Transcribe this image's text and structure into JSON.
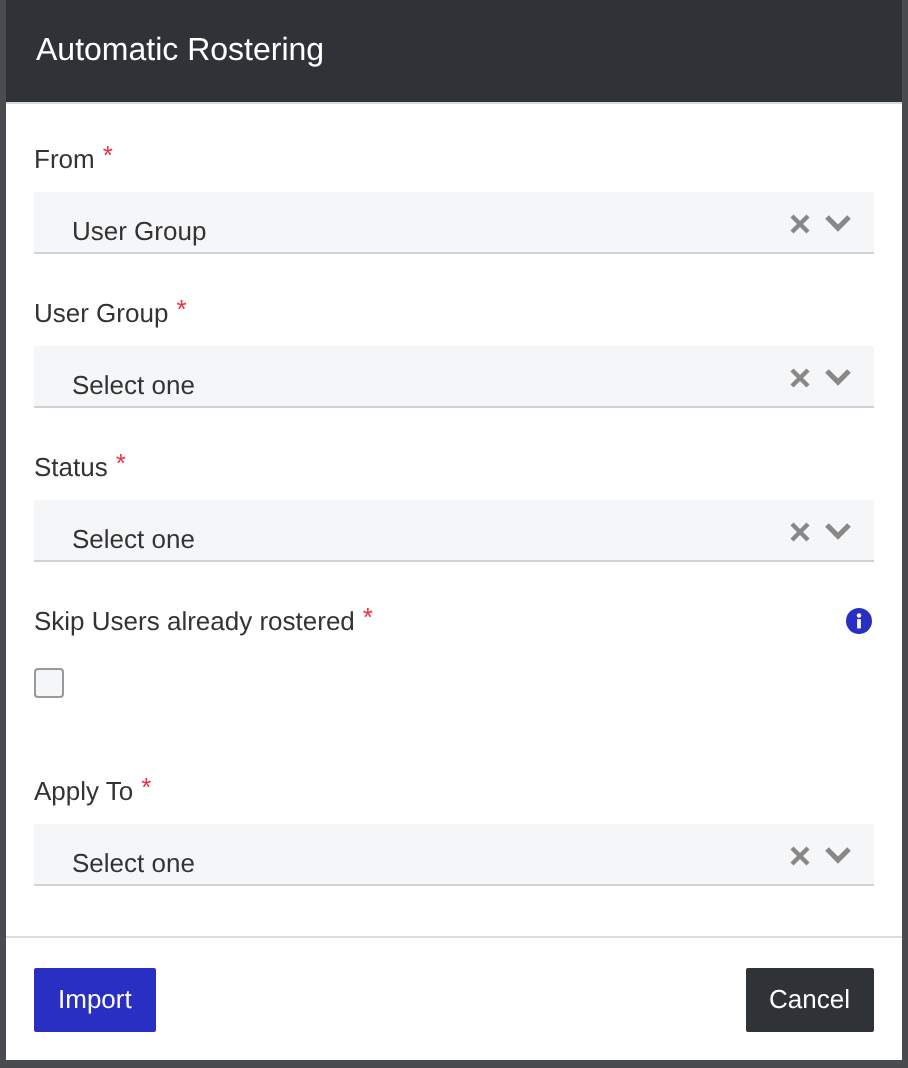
{
  "dialog": {
    "title": "Automatic Rostering"
  },
  "fields": [
    {
      "kind": "select",
      "label": "From",
      "mark": "*",
      "value": "User Group"
    },
    {
      "kind": "select",
      "label": "User Group",
      "mark": "*",
      "placeholder": "Select one"
    },
    {
      "kind": "select",
      "label": "Status",
      "mark": "*",
      "placeholder": "Select one"
    },
    {
      "kind": "checkbox",
      "label": "Skip Users already rostered",
      "mark": "*",
      "info": true,
      "checked": false
    },
    {
      "kind": "select",
      "label": "Apply To",
      "mark": "*",
      "placeholder": "Select one"
    }
  ],
  "buttons": [
    {
      "kind": "primary",
      "label": "Import"
    },
    {
      "kind": "secondary",
      "label": "Cancel"
    }
  ]
}
